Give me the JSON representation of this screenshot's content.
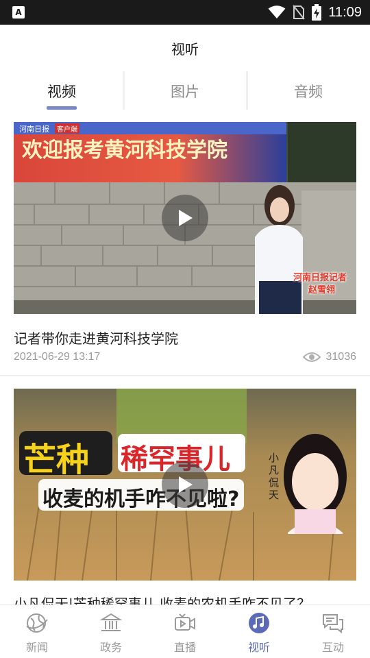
{
  "status_bar": {
    "time": "11:09",
    "left_icon": "A"
  },
  "header": {
    "title": "视听"
  },
  "tabs": [
    {
      "label": "视频",
      "active": true
    },
    {
      "label": "图片",
      "active": false
    },
    {
      "label": "音频",
      "active": false
    }
  ],
  "feed": [
    {
      "title": "记者带你走进黄河科技学院",
      "date": "2021-06-29 13:17",
      "views": "31036",
      "thumb_text": {
        "banner": "欢迎报考黄河科技学院",
        "source": "河南日报",
        "source_tag": "客户端",
        "reporter_line1": "河南日报记者",
        "reporter_line2": "赵雪翎"
      }
    },
    {
      "title": "小凡侃天|芒种稀罕事儿 收麦的农机手咋不见了？",
      "thumb_text": {
        "word1": "芒种",
        "word2": "稀罕事儿",
        "subtitle": "收麦的机手咋不见啦?",
        "side": "小凡侃天"
      }
    }
  ],
  "bottom_nav": [
    {
      "label": "新闻",
      "icon": "globe-icon",
      "active": false
    },
    {
      "label": "政务",
      "icon": "government-building-icon",
      "active": false
    },
    {
      "label": "直播",
      "icon": "live-video-icon",
      "active": false
    },
    {
      "label": "视听",
      "icon": "music-note-icon",
      "active": true
    },
    {
      "label": "互动",
      "icon": "chat-bubbles-icon",
      "active": false
    }
  ],
  "colors": {
    "accent": "#5b6bb8",
    "tab_underline": "#7b88c6",
    "status_bar": "#1a1a1a"
  }
}
